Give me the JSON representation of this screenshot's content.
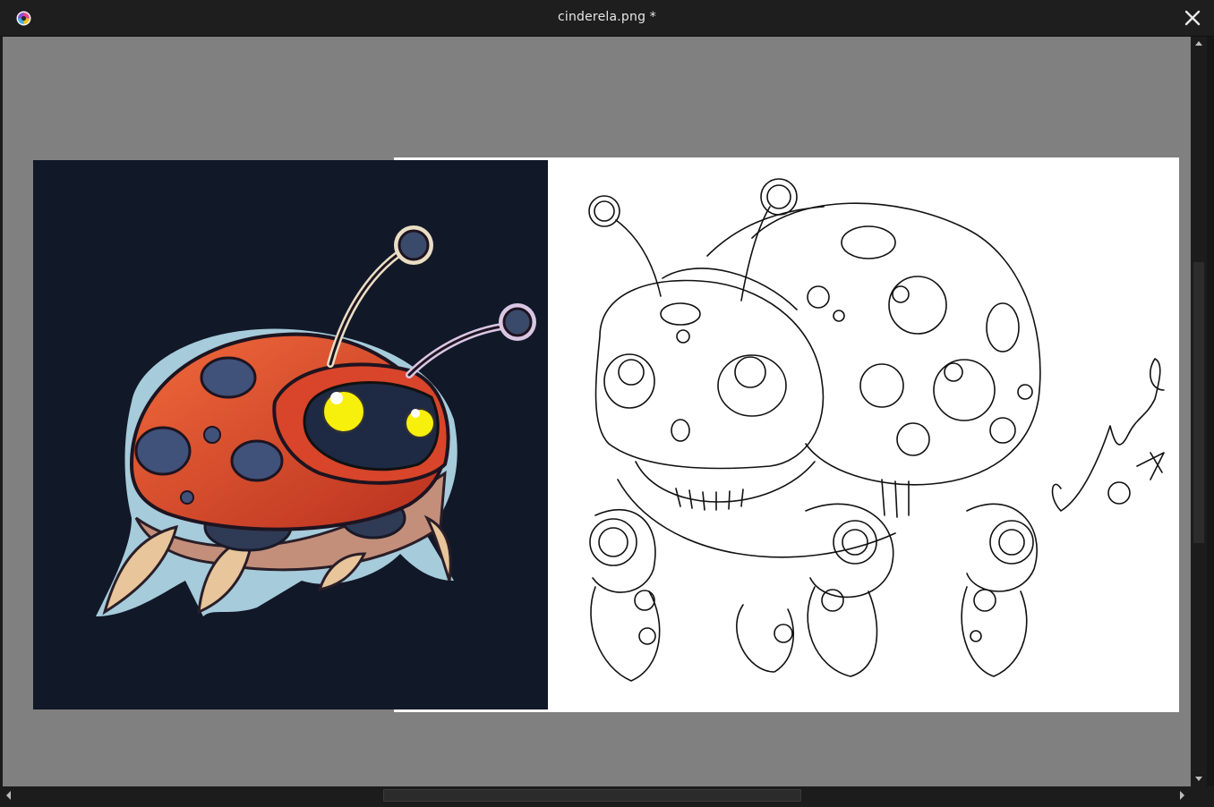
{
  "window": {
    "title": "cinderela.png *",
    "icons": {
      "app": "krita-app-icon",
      "close": "close-icon"
    }
  },
  "colors": {
    "titlebar": "#1e1e1e",
    "canvas_background": "#808080",
    "scrollbar": "#1c1c1c",
    "artwork_dark_bg": "#111827",
    "ladybug_red": "#d8452a",
    "eye_yellow": "#f7ef0c"
  },
  "scrollbars": {
    "vertical_arrows": [
      "scroll-up-arrow-icon",
      "scroll-down-arrow-icon"
    ],
    "horizontal_arrows": [
      "scroll-left-arrow-icon",
      "scroll-right-arrow-icon"
    ]
  }
}
